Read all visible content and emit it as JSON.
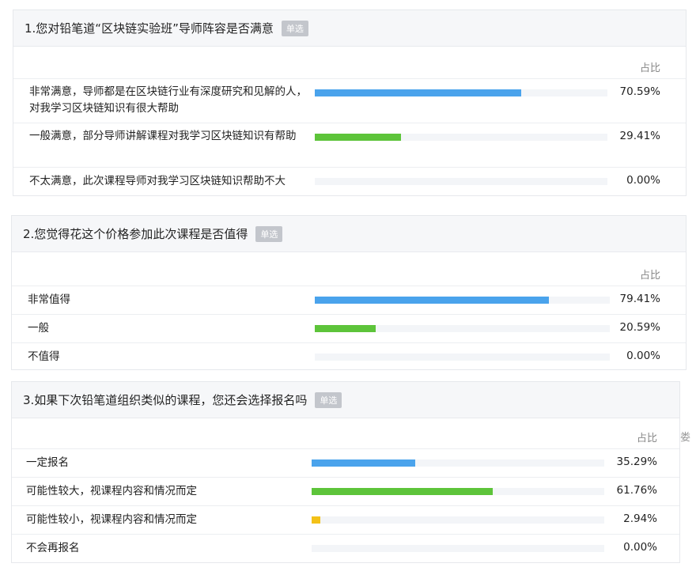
{
  "chart_data": [
    {
      "type": "bar",
      "title": "1.您对铅笔道“区块链实验班”导师阵容是否满意",
      "badge": "单选",
      "column_header": "占比",
      "categories": [
        "非常满意，导师都是在区块链行业有深度研究和见解的人，对我学习区块链知识有很大帮助",
        "一般满意，部分导师讲解课程对我学习区块链知识有帮助",
        "不太满意，此次课程导师对我学习区块链知识帮助不大"
      ],
      "values": [
        70.59,
        29.41,
        0.0
      ],
      "value_labels": [
        "70.59%",
        "29.41%",
        "0.00%"
      ],
      "bar_colors": [
        "#4aa3ec",
        "#5dc43a",
        "#f3c118"
      ],
      "ylim": [
        0,
        100
      ]
    },
    {
      "type": "bar",
      "title": "2.您觉得花这个价格参加此次课程是否值得",
      "badge": "单选",
      "column_header": "占比",
      "categories": [
        "非常值得",
        "一般",
        "不值得"
      ],
      "values": [
        79.41,
        20.59,
        0.0
      ],
      "value_labels": [
        "79.41%",
        "20.59%",
        "0.00%"
      ],
      "bar_colors": [
        "#4aa3ec",
        "#5dc43a",
        "#f3c118"
      ],
      "ylim": [
        0,
        100
      ]
    },
    {
      "type": "bar",
      "title": "3.如果下次铅笔道组织类似的课程，您还会选择报名吗",
      "badge": "单选",
      "column_header": "占比",
      "categories": [
        "一定报名",
        "可能性较大，视课程内容和情况而定",
        "可能性较小，视课程内容和情况而定",
        "不会再报名"
      ],
      "values": [
        35.29,
        61.76,
        2.94,
        0.0
      ],
      "value_labels": [
        "35.29%",
        "61.76%",
        "2.94%",
        "0.00%"
      ],
      "bar_colors": [
        "#4aa3ec",
        "#5dc43a",
        "#f3c118",
        "#e8e8e8"
      ],
      "ylim": [
        0,
        100
      ]
    }
  ],
  "edge_fragment": "娄"
}
